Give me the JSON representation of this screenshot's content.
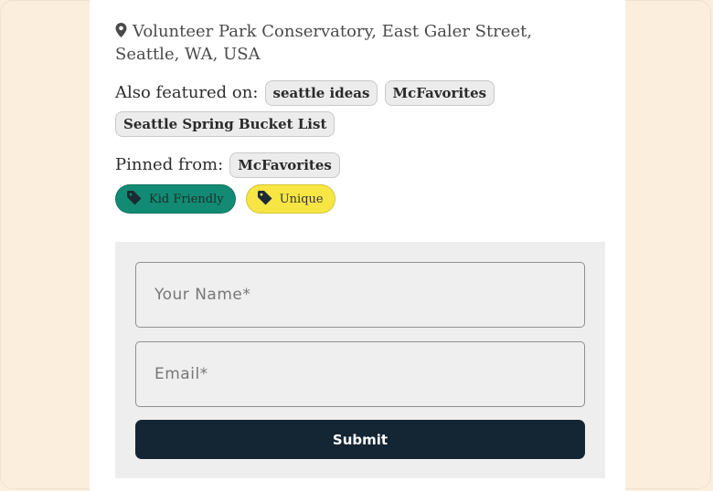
{
  "location": {
    "icon": "map-pin-icon",
    "address": "Volunteer Park Conservatory, East Galer Street, Seattle, WA, USA"
  },
  "featured": {
    "label": "Also featured on:",
    "chips": [
      "seattle ideas",
      "McFavorites",
      "Seattle Spring Bucket List"
    ]
  },
  "pinned": {
    "label": "Pinned from:",
    "chip": "McFavorites"
  },
  "tags": [
    {
      "label": "Kid Friendly",
      "color": "#138a74",
      "icon": "tag-icon"
    },
    {
      "label": "Unique",
      "color": "#f7e544",
      "icon": "tag-icon"
    }
  ],
  "form": {
    "name_placeholder": "Your Name*",
    "email_placeholder": "Email*",
    "submit_label": "Submit",
    "button_color": "#142634"
  }
}
